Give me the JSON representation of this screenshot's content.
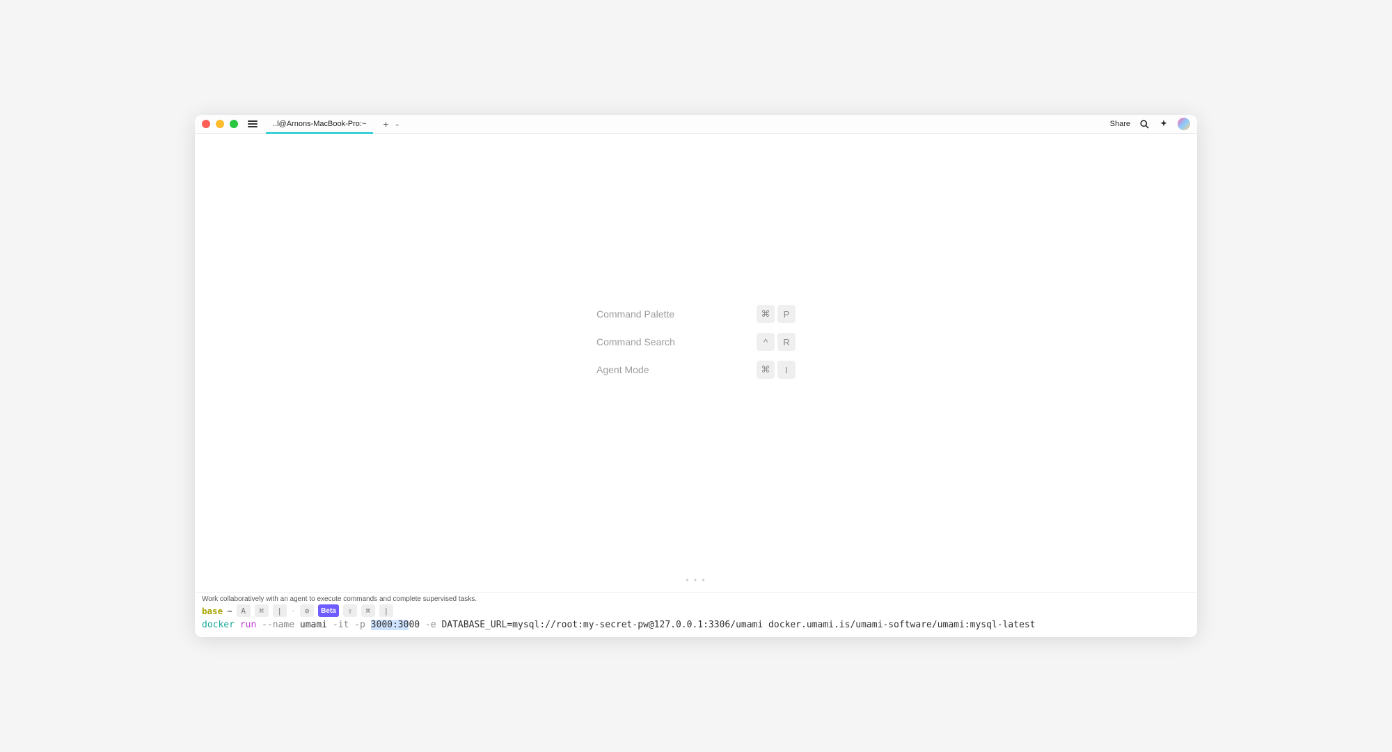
{
  "titlebar": {
    "tab_title": "..l@Arnons-MacBook-Pro:~",
    "share": "Share"
  },
  "shortcuts": [
    {
      "label": "Command Palette",
      "keys": [
        "⌘",
        "P"
      ]
    },
    {
      "label": "Command Search",
      "keys": [
        "^",
        "R"
      ]
    },
    {
      "label": "Agent Mode",
      "keys": [
        "⌘",
        "I"
      ]
    }
  ],
  "overflow": "• • •",
  "footer": {
    "hint": "Work collaboratively with an agent to execute commands and complete supervised tasks.",
    "env": "base",
    "tilde": "~",
    "beta": "Beta",
    "toolbar_keys": {
      "a": "A",
      "cmd1": "⌘",
      "pipe1": "|",
      "circle": "⊘",
      "up": "⇧",
      "cmd2": "⌘",
      "pipe2": "|"
    },
    "command": {
      "c1": "docker",
      "c2": "run",
      "c3": "--name",
      "c4": "umami",
      "c5": "-it",
      "c6": "-p",
      "c7a": "3000:30",
      "c7b": "00",
      "c8": "-e",
      "c9": "DATABASE_URL=mysql://root:my-secret-pw@127.0.0.1:3306/umami",
      "c10": "docker.umami.is/umami-software/umami:mysql-latest"
    }
  }
}
